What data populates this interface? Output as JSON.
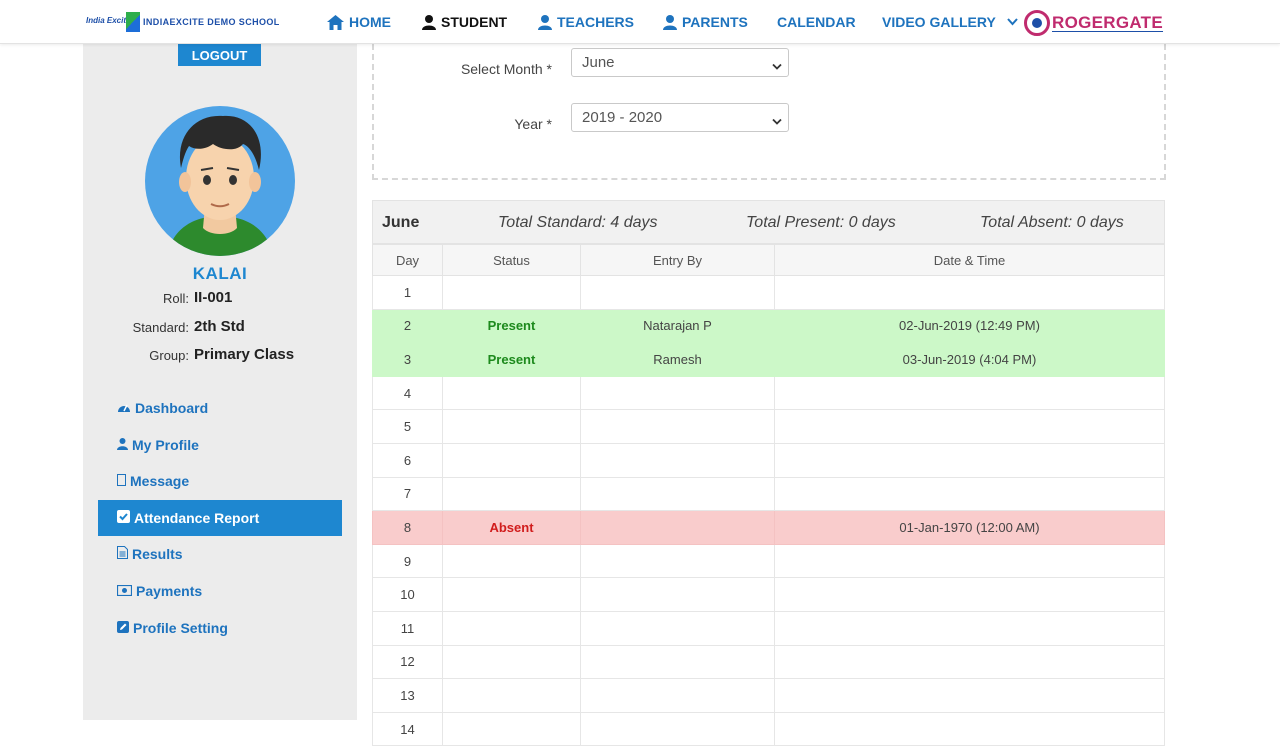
{
  "header": {
    "brand_logo_text": "India Excite",
    "brand_name": "INDIAEXCITE DEMO SCHOOL",
    "nav": {
      "home": "HOME",
      "student": "STUDENT",
      "teachers": "TEACHERS",
      "parents": "PARENTS",
      "calendar": "CALENDAR",
      "video_gallery": "VIDEO GALLERY"
    },
    "partner_logo": "ROGERGATE"
  },
  "sidebar": {
    "logout_label": "LOGOUT",
    "student": {
      "name": "KALAI",
      "roll_label": "Roll:",
      "roll": "II-001",
      "standard_label": "Standard:",
      "standard": "2th Std",
      "group_label": "Group:",
      "group": "Primary Class"
    },
    "menu": {
      "dashboard": "Dashboard",
      "my_profile": "My Profile",
      "message": "Message",
      "attendance_report": "Attendance Report",
      "results": "Results",
      "payments": "Payments",
      "profile_setting": "Profile Setting"
    }
  },
  "filter": {
    "month_label": "Select Month *",
    "month_value": "June",
    "year_label": "Year *",
    "year_value": "2019 - 2020"
  },
  "summary": {
    "month": "June",
    "total_standard": "Total Standard: 4 days",
    "total_present": "Total Present: 0 days",
    "total_absent": "Total Absent: 0 days"
  },
  "table": {
    "headers": [
      "Day",
      "Status",
      "Entry By",
      "Date & Time"
    ],
    "rows": [
      {
        "day": "1",
        "status": "",
        "entry_by": "",
        "datetime": ""
      },
      {
        "day": "2",
        "status": "Present",
        "entry_by": "Natarajan P",
        "datetime": "02-Jun-2019 (12:49 PM)"
      },
      {
        "day": "3",
        "status": "Present",
        "entry_by": "Ramesh",
        "datetime": "03-Jun-2019 (4:04 PM)"
      },
      {
        "day": "4",
        "status": "",
        "entry_by": "",
        "datetime": ""
      },
      {
        "day": "5",
        "status": "",
        "entry_by": "",
        "datetime": ""
      },
      {
        "day": "6",
        "status": "",
        "entry_by": "",
        "datetime": ""
      },
      {
        "day": "7",
        "status": "",
        "entry_by": "",
        "datetime": ""
      },
      {
        "day": "8",
        "status": "Absent",
        "entry_by": "",
        "datetime": "01-Jan-1970 (12:00 AM)"
      },
      {
        "day": "9",
        "status": "",
        "entry_by": "",
        "datetime": ""
      },
      {
        "day": "10",
        "status": "",
        "entry_by": "",
        "datetime": ""
      },
      {
        "day": "11",
        "status": "",
        "entry_by": "",
        "datetime": ""
      },
      {
        "day": "12",
        "status": "",
        "entry_by": "",
        "datetime": ""
      },
      {
        "day": "13",
        "status": "",
        "entry_by": "",
        "datetime": ""
      },
      {
        "day": "14",
        "status": "",
        "entry_by": "",
        "datetime": ""
      }
    ]
  },
  "colors": {
    "primary": "#1e87d0",
    "nav_link": "#1e73be",
    "present_row": "#ccf8c8",
    "absent_row": "#f9cccc",
    "present_text": "#1d8a1d",
    "absent_text": "#d11d1d"
  },
  "icons": {
    "home": "home-icon",
    "student": "user-icon",
    "teachers": "user-icon",
    "parents": "user-icon",
    "video_gallery": "chevron-down-icon",
    "dashboard": "dashboard-gauge-icon",
    "my_profile": "user-icon",
    "message": "message-icon",
    "attendance_report": "checkbox-icon",
    "results": "document-icon",
    "payments": "money-icon",
    "profile_setting": "edit-icon"
  }
}
